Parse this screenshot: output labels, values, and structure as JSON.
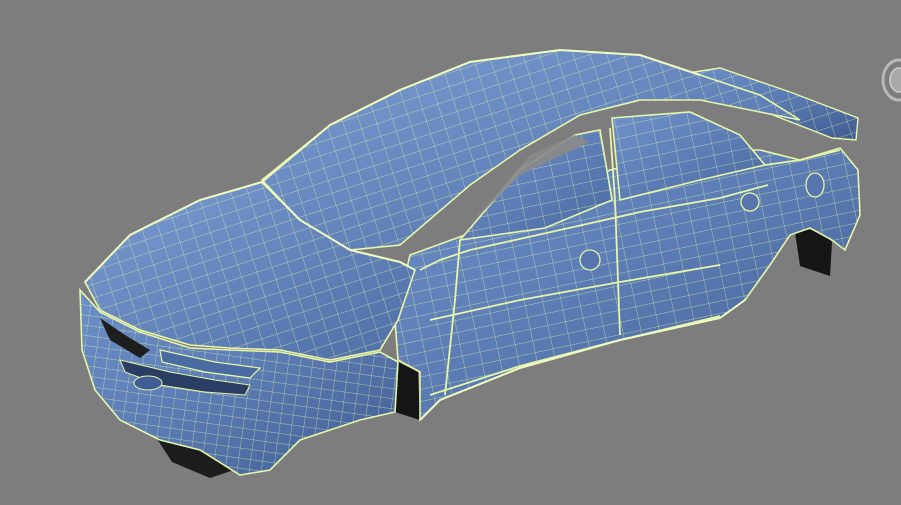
{
  "viewport": {
    "background_color": "#7d7d7d",
    "model": {
      "subject": "car-body-wireframe",
      "surface_color": "#5b7fb8",
      "wire_color": "#e6f5a8",
      "shadow_color": "#1a1a1a"
    },
    "viewcube": {
      "icon": "viewcube-gizmo-icon"
    }
  }
}
